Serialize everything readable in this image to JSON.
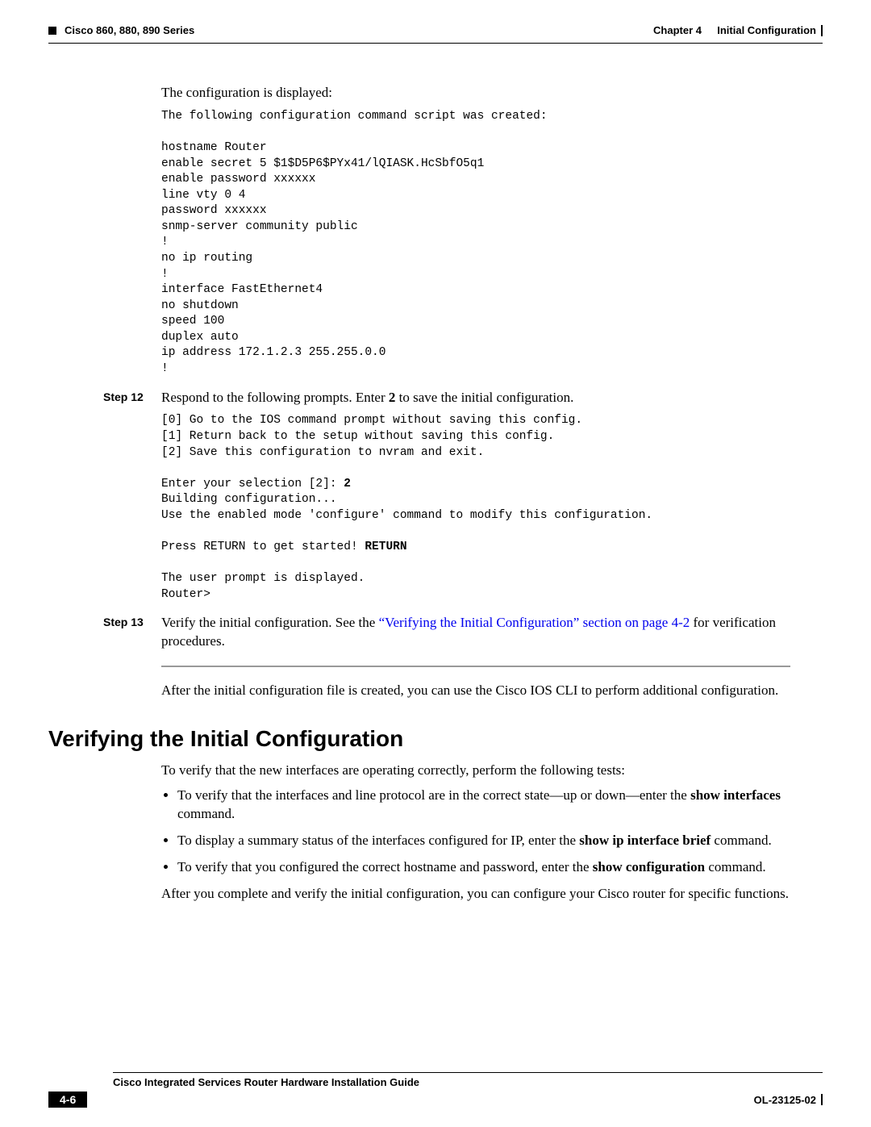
{
  "header": {
    "left": "Cisco 860, 880, 890 Series",
    "right_chapter": "Chapter 4",
    "right_title": "Initial Configuration"
  },
  "intro_para": "The configuration is displayed:",
  "code1": "The following configuration command script was created:\n\nhostname Router\nenable secret 5 $1$D5P6$PYx41/lQIASK.HcSbfO5q1\nenable password xxxxxx\nline vty 0 4\npassword xxxxxx\nsnmp-server community public\n!\nno ip routing\n!\ninterface FastEthernet4\nno shutdown\nspeed 100\nduplex auto\nip address 172.1.2.3 255.255.0.0\n!",
  "step12": {
    "label": "Step 12",
    "text_before": "Respond to the following prompts. Enter ",
    "bold_num": "2",
    "text_after": " to save the initial configuration."
  },
  "code2_part1": "[0] Go to the IOS command prompt without saving this config.\n[1] Return back to the setup without saving this config.\n[2] Save this configuration to nvram and exit.\n\nEnter your selection [2]: ",
  "code2_bold1": "2",
  "code2_part2": "\nBuilding configuration...\nUse the enabled mode 'configure' command to modify this configuration.\n\nPress RETURN to get started! ",
  "code2_bold2": "RETURN",
  "code2_part3": "\n\nThe user prompt is displayed.\nRouter>",
  "step13": {
    "label": "Step 13",
    "text_before": "Verify the initial configuration. See the ",
    "link_text": "“Verifying the Initial Configuration” section on page 4-2",
    "text_after": " for verification procedures."
  },
  "after_hr_para": "After the initial configuration file is created, you can use the Cisco IOS CLI to perform additional configuration.",
  "section_heading": "Verifying the Initial Configuration",
  "verify_intro": "To verify that the new interfaces are operating correctly, perform the following tests:",
  "bullets": {
    "b1_a": "To verify that the interfaces and line protocol are in the correct state—up or down—enter the ",
    "b1_bold": "show interfaces",
    "b1_c": " command.",
    "b2_a": "To display a summary status of the interfaces configured for IP, enter the ",
    "b2_bold": "show ip interface brief",
    "b2_c": " command.",
    "b3_a": "To verify that you configured the correct hostname and password, enter the ",
    "b3_bold": "show configuration",
    "b3_c": " command."
  },
  "closing_para": "After you complete and verify the initial configuration, you can configure your Cisco router for specific functions.",
  "footer": {
    "title": "Cisco Integrated Services Router Hardware Installation Guide",
    "page": "4-6",
    "doc": "OL-23125-02"
  }
}
